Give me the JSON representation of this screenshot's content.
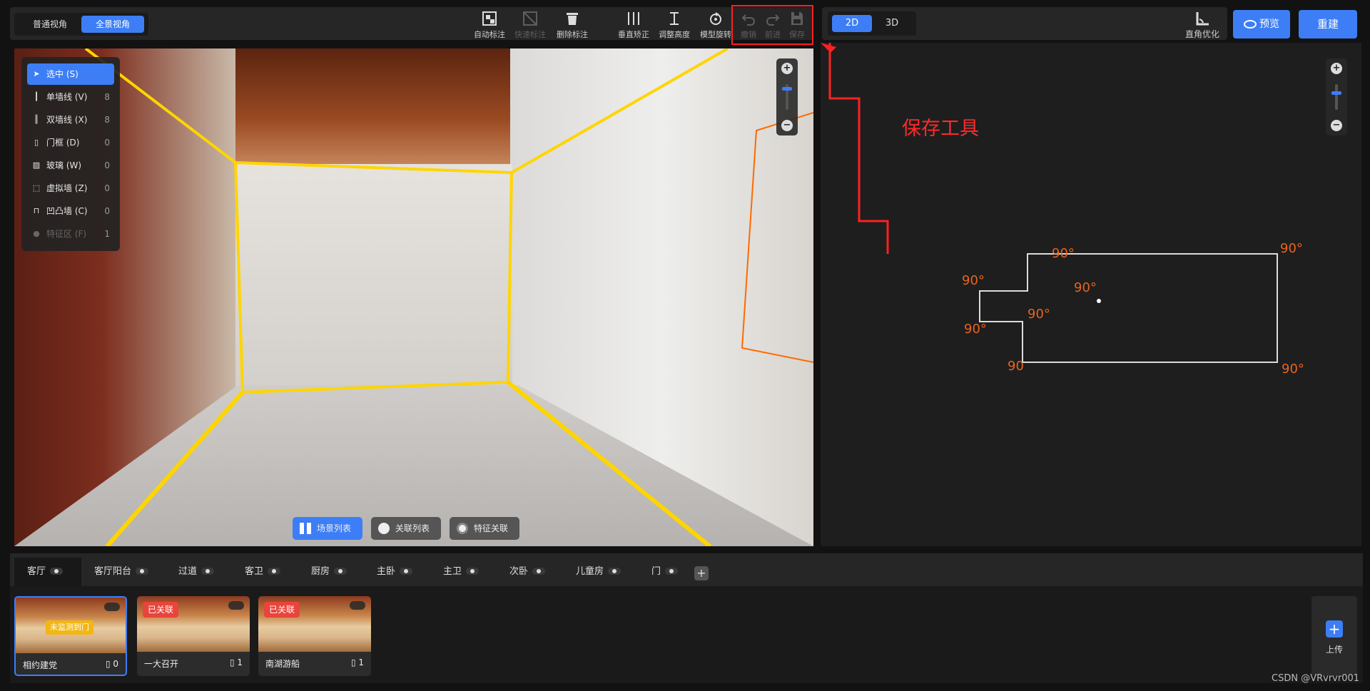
{
  "view_modes": [
    "普通视角",
    "全景视角"
  ],
  "toolbar": [
    {
      "label": "自动标注",
      "icon": "auto-annotate-icon",
      "enabled": true
    },
    {
      "label": "快速标注",
      "icon": "quick-annotate-icon",
      "enabled": false
    },
    {
      "label": "删除标注",
      "icon": "trash-icon",
      "enabled": true
    },
    {
      "label": "垂直矫正",
      "icon": "vertical-correct-icon",
      "enabled": true
    },
    {
      "label": "调整高度",
      "icon": "height-icon",
      "enabled": true
    },
    {
      "label": "模型旋转",
      "icon": "rotate-icon",
      "enabled": true
    },
    {
      "label": "撤销",
      "icon": "undo-icon",
      "enabled": false
    },
    {
      "label": "前进",
      "icon": "redo-icon",
      "enabled": false
    },
    {
      "label": "保存",
      "icon": "save-icon",
      "enabled": false
    }
  ],
  "dim_modes": [
    "2D",
    "3D"
  ],
  "right_toolbar": {
    "optimize": "直角优化",
    "preview": "预览",
    "rebuild": "重建"
  },
  "tool_menu": [
    {
      "label": "选中 (S)",
      "count": "",
      "icon": "cursor-icon",
      "selected": true
    },
    {
      "label": "单墙线 (V)",
      "count": "8",
      "icon": "single-wall-icon"
    },
    {
      "label": "双墙线 (X)",
      "count": "8",
      "icon": "double-wall-icon"
    },
    {
      "label": "门框 (D)",
      "count": "0",
      "icon": "door-frame-icon"
    },
    {
      "label": "玻璃 (W)",
      "count": "0",
      "icon": "glass-icon"
    },
    {
      "label": "虚拟墙 (Z)",
      "count": "0",
      "icon": "virtual-wall-icon"
    },
    {
      "label": "凹凸墙 (C)",
      "count": "0",
      "icon": "bump-wall-icon"
    },
    {
      "label": "特征区 (F)",
      "count": "1",
      "icon": "feature-area-icon",
      "disabled": true
    }
  ],
  "pano_pills": [
    "场景列表",
    "关联列表",
    "特征关联"
  ],
  "plan": {
    "angles": [
      "90°",
      "90°",
      "90°",
      "90°",
      "90°",
      "90°",
      "90",
      "90°"
    ],
    "annotation": "保存工具"
  },
  "rooms": [
    "客厅",
    "客厅阳台",
    "过道",
    "客卫",
    "厨房",
    "主卧",
    "主卫",
    "次卧",
    "儿童房",
    "门"
  ],
  "scenes": [
    {
      "name": "相约建党",
      "count": "0",
      "tag": "未监测到门",
      "selected": true
    },
    {
      "name": "一大召开",
      "count": "1",
      "tag": "已关联"
    },
    {
      "name": "南湖游船",
      "count": "1",
      "tag": "已关联"
    }
  ],
  "upload_label": "上传",
  "credit": "CSDN @VRvrvr001",
  "colors": {
    "accent": "#3d7ef6",
    "annotation": "#ff2a2a",
    "angle": "#e8641e",
    "wall_line": "#ffd500"
  }
}
